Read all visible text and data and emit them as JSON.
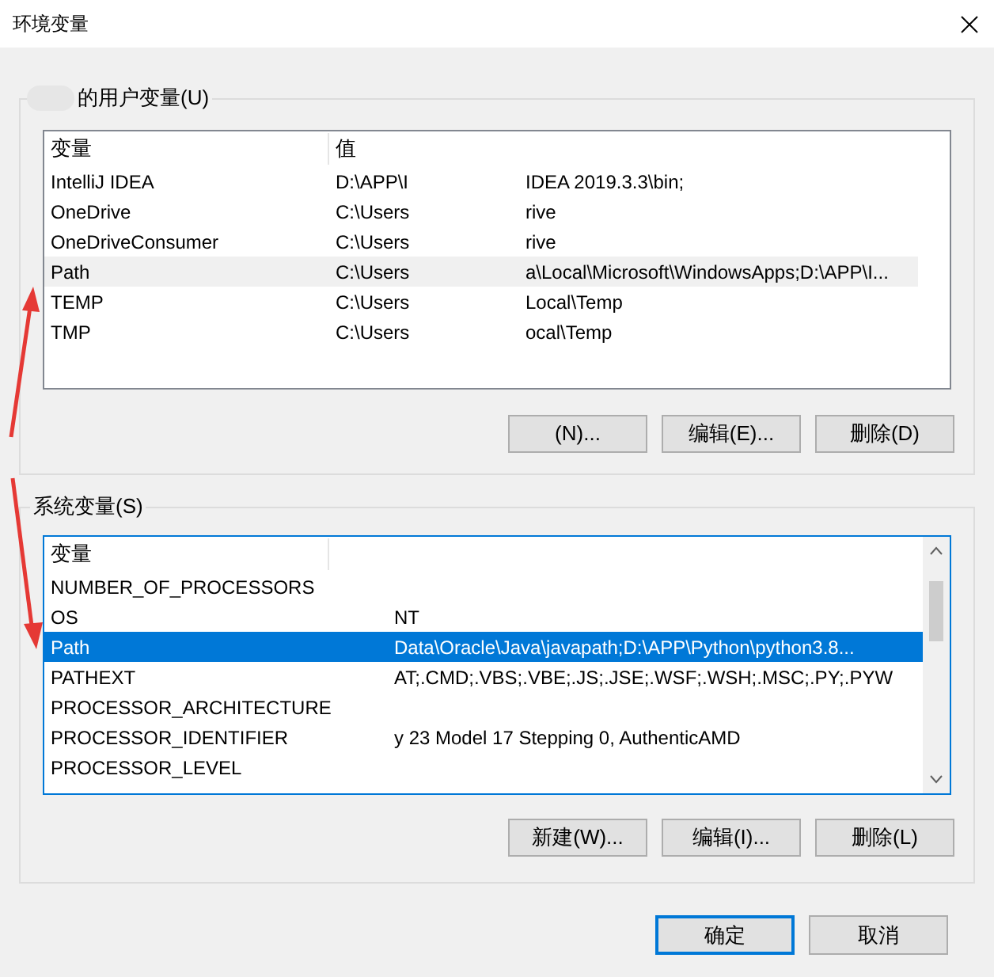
{
  "window": {
    "title": "环境变量"
  },
  "user_vars": {
    "title": "的用户变量(U)",
    "focused": false,
    "columns": [
      "变量",
      "值"
    ],
    "rows": [
      {
        "name": "IntelliJ IDEA",
        "value_head": "D:\\APP\\I",
        "value_tail": "IDEA 2019.3.3\\bin;",
        "selected": false
      },
      {
        "name": "OneDrive",
        "value_head": "C:\\Users",
        "value_tail": "rive",
        "selected": false
      },
      {
        "name": "OneDriveConsumer",
        "value_head": "C:\\Users",
        "value_tail": "rive",
        "selected": false
      },
      {
        "name": "Path",
        "value_head": "C:\\Users",
        "value_tail": "a\\Local\\Microsoft\\WindowsApps;D:\\APP\\I...",
        "selected": true
      },
      {
        "name": "TEMP",
        "value_head": "C:\\Users",
        "value_tail": "Local\\Temp",
        "selected": false
      },
      {
        "name": "TMP",
        "value_head": "C:\\Users",
        "value_tail": "ocal\\Temp",
        "selected": false
      }
    ],
    "buttons": [
      "(N)...",
      "编辑(E)...",
      "删除(D)"
    ]
  },
  "system_vars": {
    "title": "系统变量(S)",
    "focused": true,
    "columns": [
      "变量"
    ],
    "rows": [
      {
        "name": "NUMBER_OF_PROCESSORS",
        "selected": false
      },
      {
        "name": "OS",
        "value_tail": "NT",
        "selected": false
      },
      {
        "name": "Path",
        "value_tail": "Data\\Oracle\\Java\\javapath;D:\\APP\\Python\\python3.8...",
        "selected": true
      },
      {
        "name": "PATHEXT",
        "value_tail": "AT;.CMD;.VBS;.VBE;.JS;.JSE;.WSF;.WSH;.MSC;.PY;.PYW",
        "selected": false
      },
      {
        "name": "PROCESSOR_ARCHITECTURE",
        "selected": false
      },
      {
        "name": "PROCESSOR_IDENTIFIER",
        "value_tail": "y 23 Model 17 Stepping 0, AuthenticAMD",
        "selected": false
      },
      {
        "name": "PROCESSOR_LEVEL",
        "selected": false
      }
    ],
    "buttons": [
      "新建(W)...",
      "编辑(I)...",
      "删除(L)"
    ]
  },
  "footer_buttons": [
    {
      "label": "确定",
      "default": true
    },
    {
      "label": "取消",
      "default": false
    }
  ]
}
